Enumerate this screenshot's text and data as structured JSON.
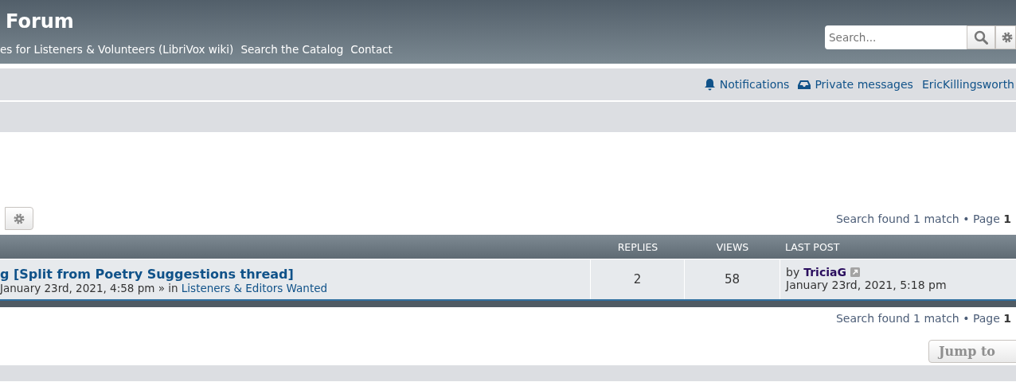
{
  "header": {
    "title": "Forum",
    "links": [
      "es for Listeners & Volunteers (LibriVox wiki)",
      "Search the Catalog",
      "Contact"
    ],
    "search": {
      "placeholder": "Search..."
    }
  },
  "navbar": {
    "items": [
      {
        "kind": "bell",
        "label": "Notifications"
      },
      {
        "kind": "inbox",
        "label": "Private messages"
      },
      {
        "kind": "user",
        "label": "EricKillingsworth"
      }
    ]
  },
  "pagination_top": {
    "text": "Search found 1 match • Page **1**"
  },
  "table": {
    "columns": [
      "REPLIES",
      "VIEWS",
      "LAST POST"
    ],
    "rows": [
      {
        "title": "g [Split from Poetry Suggestions thread]",
        "meta": "January 23rd, 2021, 4:58 pm » in",
        "forum": "Listeners & Editors Wanted",
        "replies": "2",
        "views": "58",
        "last_by": "by",
        "last_user": "TriciaG",
        "last_time": "January 23rd, 2021, 5:18 pm"
      }
    ]
  },
  "pagination_bottom": {
    "text": "Search found 1 match • Page **1**"
  },
  "jump_to": "Jump to"
}
